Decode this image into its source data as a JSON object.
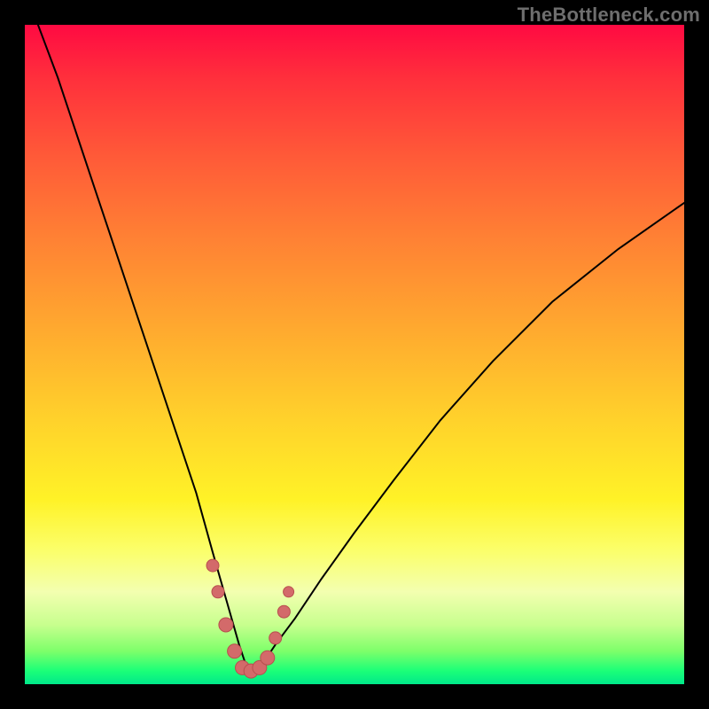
{
  "watermark": {
    "text": "TheBottleneck.com"
  },
  "colors": {
    "frame": "#000000",
    "curve": "#000000",
    "marker_fill": "#d36a6a",
    "marker_stroke": "#b84e4e"
  },
  "chart_data": {
    "type": "line",
    "title": "",
    "xlabel": "",
    "ylabel": "",
    "xlim": [
      0,
      100
    ],
    "ylim": [
      0,
      100
    ],
    "grid": false,
    "legend": false,
    "notes": "Two unlabeled curves descending into a V-shaped minimum near x≈34; markers cluster near the trough. Background is a vertical red→green heat gradient. Values are estimated from pixel positions (no axis ticks rendered).",
    "series": [
      {
        "name": "left-branch",
        "x": [
          2,
          5,
          8,
          11,
          14,
          17,
          20,
          23,
          26,
          28.5,
          30.5,
          32.5,
          34
        ],
        "y": [
          100,
          92,
          83,
          74,
          65,
          56,
          47,
          38,
          29,
          20,
          13,
          6,
          1.5
        ]
      },
      {
        "name": "right-branch",
        "x": [
          34,
          36,
          38,
          41,
          45,
          50,
          56,
          63,
          71,
          80,
          90,
          100
        ],
        "y": [
          1.5,
          3,
          6,
          10,
          16,
          23,
          31,
          40,
          49,
          58,
          66,
          73
        ]
      }
    ],
    "markers": [
      {
        "x": 28.5,
        "y": 18,
        "r": 7
      },
      {
        "x": 29.3,
        "y": 14,
        "r": 7
      },
      {
        "x": 30.5,
        "y": 9,
        "r": 8
      },
      {
        "x": 31.8,
        "y": 5,
        "r": 8
      },
      {
        "x": 33.0,
        "y": 2.5,
        "r": 8
      },
      {
        "x": 34.3,
        "y": 2,
        "r": 8
      },
      {
        "x": 35.6,
        "y": 2.5,
        "r": 8
      },
      {
        "x": 36.8,
        "y": 4,
        "r": 8
      },
      {
        "x": 38.0,
        "y": 7,
        "r": 7
      },
      {
        "x": 39.3,
        "y": 11,
        "r": 7
      },
      {
        "x": 40.0,
        "y": 14,
        "r": 6
      }
    ]
  }
}
